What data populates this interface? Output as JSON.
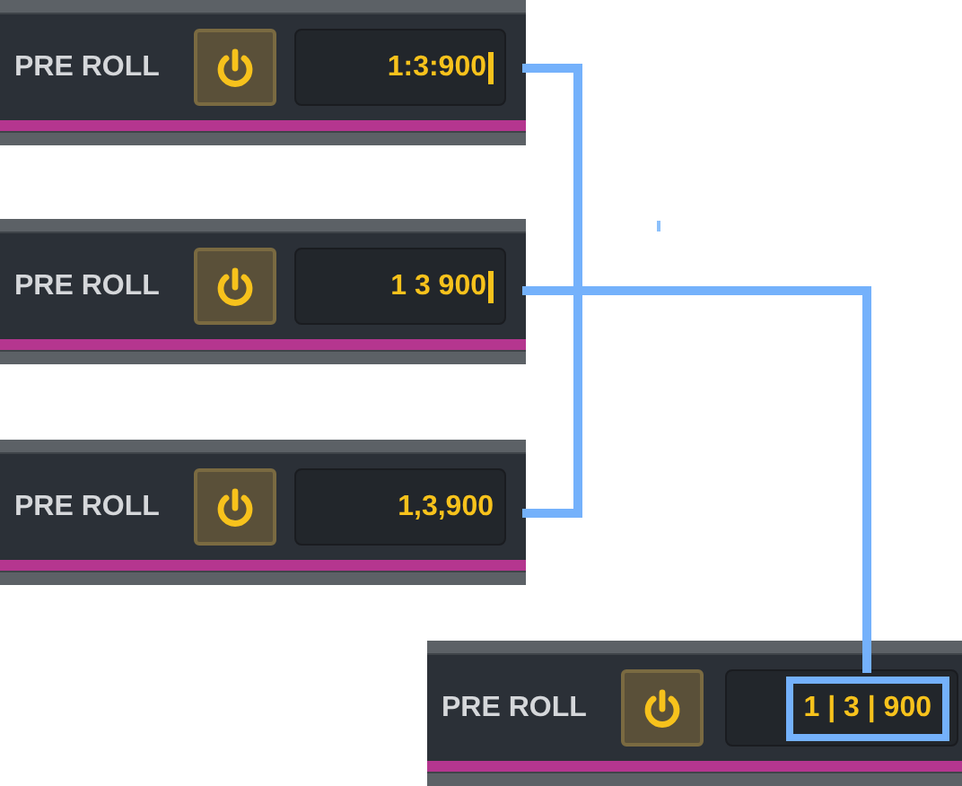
{
  "panels": [
    {
      "label": "PRE ROLL",
      "value": "1:3:900",
      "cursor": true,
      "highlighted": false
    },
    {
      "label": "PRE ROLL",
      "value": "1 3 900",
      "cursor": true,
      "highlighted": false
    },
    {
      "label": "PRE ROLL",
      "value": "1,3,900",
      "cursor": false,
      "highlighted": false
    },
    {
      "label": "PRE ROLL",
      "value": "1 | 3 | 900",
      "cursor": false,
      "highlighted": true
    }
  ]
}
